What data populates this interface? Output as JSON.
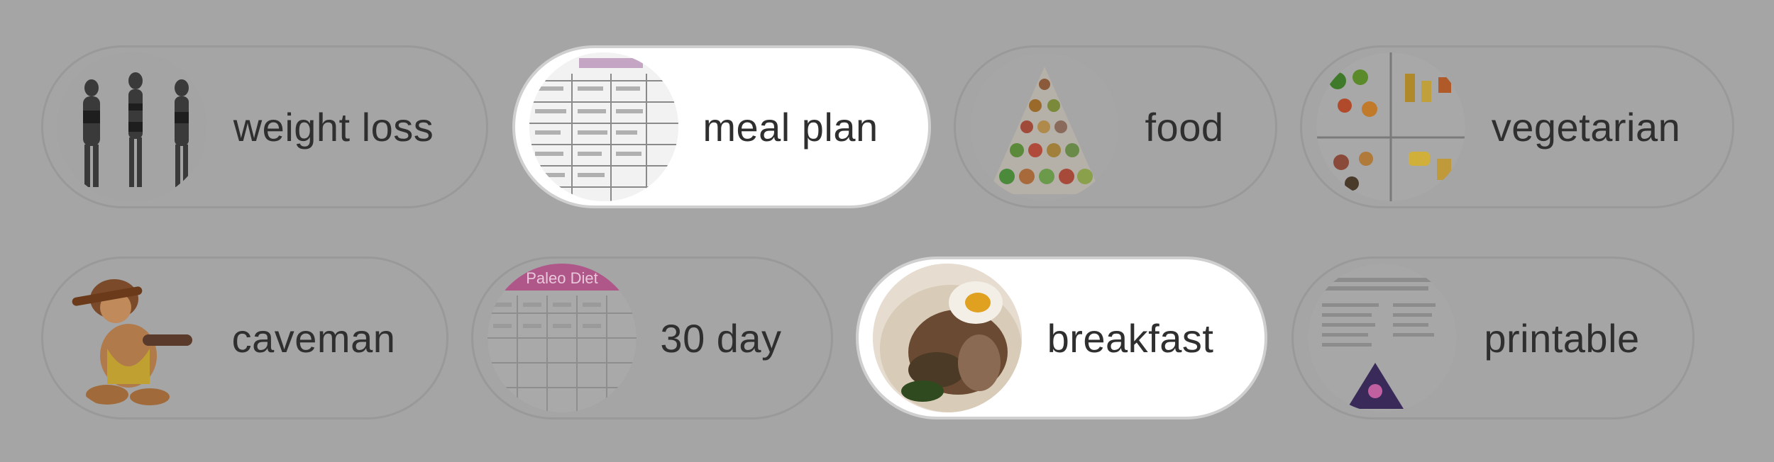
{
  "chips": [
    {
      "label": "weight loss",
      "thumb": "weight-loss-thumbnail",
      "active": false
    },
    {
      "label": "meal plan",
      "thumb": "meal-plan-thumbnail",
      "active": true
    },
    {
      "label": "food",
      "thumb": "food-pyramid-thumbnail",
      "active": false
    },
    {
      "label": "vegetarian",
      "thumb": "vegetarian-chart-thumbnail",
      "active": false
    },
    {
      "label": "caveman",
      "thumb": "caveman-thumbnail",
      "active": false
    },
    {
      "label": "30 day",
      "thumb": "30-day-plan-thumbnail",
      "active": false
    },
    {
      "label": "breakfast",
      "thumb": "breakfast-thumbnail",
      "active": true
    },
    {
      "label": "printable",
      "thumb": "printable-thumbnail",
      "active": false
    }
  ],
  "thumb_text": {
    "paleo_header": "Paleo Diet"
  },
  "colors": {
    "background": "#a5a5a5",
    "chip_active": "#ffffff",
    "text": "#2f2f2f"
  }
}
